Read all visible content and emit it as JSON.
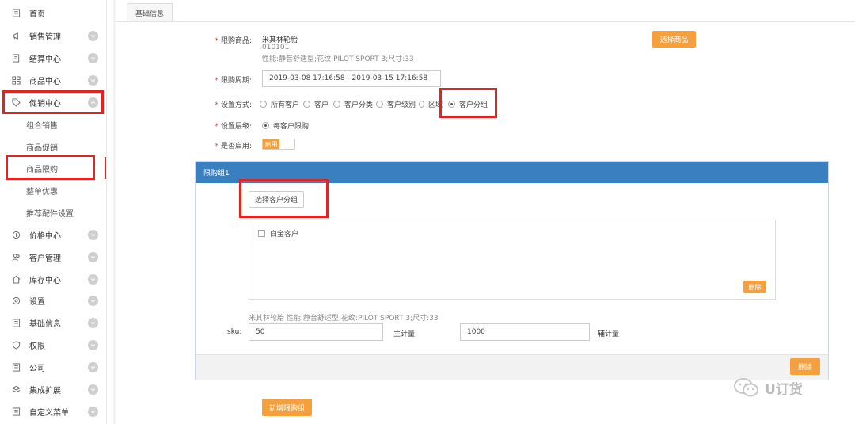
{
  "sidebar": {
    "items": [
      {
        "label": "首页",
        "icon": "doc-icon",
        "chevron": false
      },
      {
        "label": "销售管理",
        "icon": "megaphone-icon",
        "chevron": true
      },
      {
        "label": "结算中心",
        "icon": "invoice-icon",
        "chevron": true
      },
      {
        "label": "商品中心",
        "icon": "grid-icon",
        "chevron": true
      },
      {
        "label": "促销中心",
        "icon": "tag-icon",
        "chevron": true,
        "expanded": true
      }
    ],
    "sub_items": [
      {
        "label": "组合销售"
      },
      {
        "label": "商品促销"
      },
      {
        "label": "商品限购",
        "active": true
      },
      {
        "label": "整单优惠"
      },
      {
        "label": "推荐配件设置"
      }
    ],
    "items_after": [
      {
        "label": "价格中心",
        "icon": "price-icon"
      },
      {
        "label": "客户管理",
        "icon": "users-icon"
      },
      {
        "label": "库存中心",
        "icon": "home-icon"
      },
      {
        "label": "设置",
        "icon": "settings-icon"
      },
      {
        "label": "基础信息",
        "icon": "doc-icon"
      },
      {
        "label": "权限",
        "icon": "shield-icon"
      },
      {
        "label": "公司",
        "icon": "doc-icon"
      },
      {
        "label": "集成扩展",
        "icon": "layers-icon"
      },
      {
        "label": "自定义菜单",
        "icon": "doc-icon"
      }
    ]
  },
  "tab": {
    "label": "基础信息"
  },
  "form": {
    "product_label": "限购商品:",
    "product_name": "米其林轮胎",
    "product_code": "010101",
    "product_spec": "性能:静音舒适型;花纹:PILOT SPORT 3;尺寸:33",
    "select_product_btn": "选择商品",
    "period_label": "限购周期:",
    "period_value": "2019-03-08 17:16:58 - 2019-03-15 17:16:58",
    "method_label": "设置方式:",
    "method_options": [
      "所有客户",
      "客户",
      "客户分类",
      "客户级别",
      "区域",
      "客户分组"
    ],
    "method_selected": "客户分组",
    "level_label": "设置层级:",
    "level_option": "每客户限购",
    "enable_label": "是否启用:",
    "enable_value": "启用"
  },
  "panel": {
    "title": "限购组1",
    "select_group_btn": "选择客户分组",
    "group_item": "白金客户",
    "delete_small_btn": "删除",
    "product_summary": "米其林轮胎 性能:静音舒适型;花纹:PILOT SPORT 3;尺寸:33",
    "sku_label": "sku:",
    "sku_value": "50",
    "main_qty_label": "主计量",
    "main_qty_value": "1000",
    "aux_qty_label": "辅计量",
    "delete_btn": "删除"
  },
  "add_group_btn": "新增限购组",
  "watermark": "U订货",
  "colors": {
    "accent": "#f5a03c",
    "panel_header": "#3a7fc0",
    "highlight": "#e32222"
  }
}
